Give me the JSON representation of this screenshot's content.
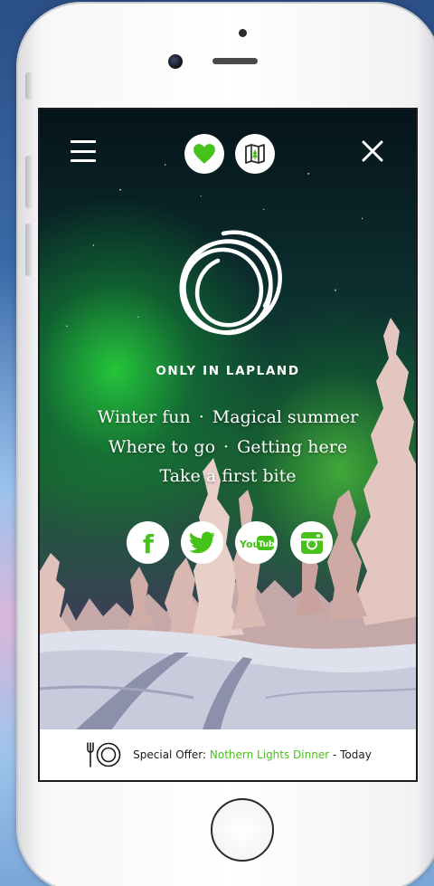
{
  "header": {
    "menu_icon": "hamburger-icon",
    "favorites_icon": "heart-icon",
    "map_icon": "map-icon",
    "close_icon": "close-icon"
  },
  "brand": {
    "name": "ONLY IN LAPLAND",
    "logo_icon": "lapland-knot-logo"
  },
  "nav": {
    "items": [
      {
        "label": "Winter fun"
      },
      {
        "label": "Magical summer"
      },
      {
        "label": "Where to go"
      },
      {
        "label": "Getting here"
      },
      {
        "label": "Take a first bite"
      }
    ],
    "separator": "·"
  },
  "social": [
    {
      "name": "facebook",
      "icon": "facebook-icon",
      "glyph": "f"
    },
    {
      "name": "twitter",
      "icon": "twitter-icon"
    },
    {
      "name": "youtube",
      "icon": "youtube-icon",
      "glyph_you": "You",
      "glyph_tube": "Tube"
    },
    {
      "name": "instagram",
      "icon": "instagram-icon"
    }
  ],
  "offer": {
    "icon": "dinner-plate-icon",
    "prefix": "Special Offer: ",
    "title": "Nothern Lights Dinner",
    "suffix": " - Today"
  },
  "colors": {
    "accent": "#47c21a",
    "white": "#ffffff",
    "text_dark": "#1a1a1a"
  }
}
